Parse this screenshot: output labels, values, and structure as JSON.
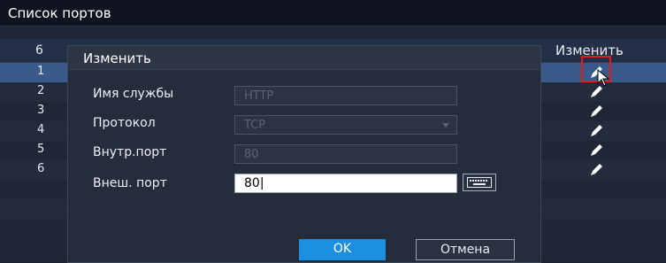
{
  "window": {
    "title": "Список портов"
  },
  "port_list": {
    "count_header": "6",
    "edit_header": "Изменить",
    "rows": [
      {
        "num": "1"
      },
      {
        "num": "2"
      },
      {
        "num": "3"
      },
      {
        "num": "4"
      },
      {
        "num": "5"
      },
      {
        "num": "6"
      }
    ]
  },
  "dialog": {
    "title": "Изменить",
    "fields": {
      "service_name": {
        "label": "Имя службы",
        "value": "HTTP"
      },
      "protocol": {
        "label": "Протокол",
        "value": "TCP"
      },
      "internal_port": {
        "label": "Внутр.порт",
        "value": "80"
      },
      "external_port": {
        "label": "Внеш. порт",
        "value": "80|"
      }
    },
    "ok_label": "OK",
    "cancel_label": "Отмена"
  },
  "colors": {
    "accent": "#1d8fe0",
    "highlight": "#e21b1b",
    "selected_row": "#3a5a8a"
  }
}
